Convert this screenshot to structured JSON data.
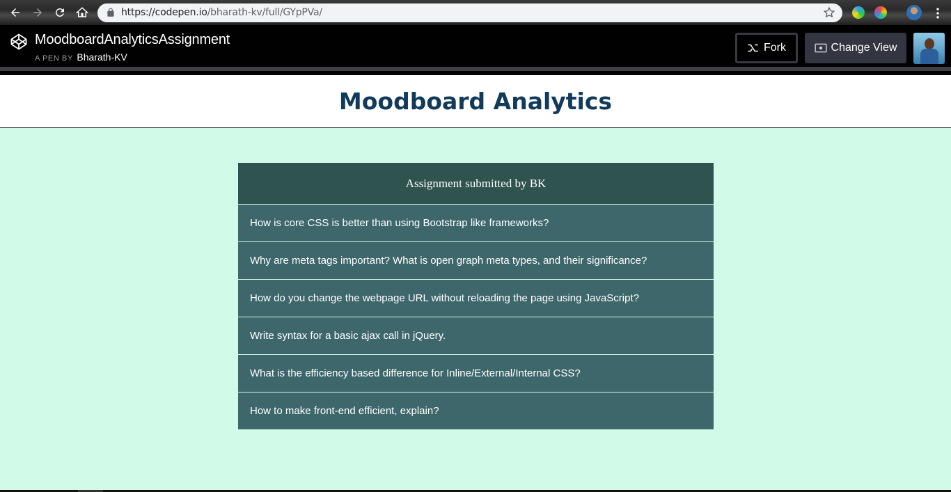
{
  "browser": {
    "url_host": "https://codepen.io",
    "url_path": "/bharath-kv/full/GYpPVa/"
  },
  "codepen": {
    "pen_title": "MoodboardAnalyticsAssignment",
    "by_label": "A PEN BY",
    "author": "Bharath-KV",
    "fork_label": "Fork",
    "change_view_label": "Change View"
  },
  "page": {
    "title": "Moodboard Analytics",
    "card_header": "Assignment submitted by BK",
    "questions": [
      "How is core CSS is better than using Bootstrap like frameworks?",
      "Why are meta tags important? What is open graph meta types, and their significance?",
      "How do you change the webpage URL without reloading the page using JavaScript?",
      "Write syntax for a basic ajax call in jQuery.",
      "What is the efficiency based difference for Inline/External/Internal CSS?",
      "How to make front-end efficient, explain?"
    ]
  },
  "colors": {
    "page_background": "#d1fbe8",
    "card_header": "#2f5450",
    "card_item": "#3e676b",
    "title": "#123a5a"
  },
  "icons": [
    "back-icon",
    "forward-icon",
    "reload-icon",
    "home-icon",
    "lock-icon",
    "star-icon",
    "codepen-logo-icon",
    "fork-icon",
    "eye-icon",
    "menu-icon"
  ]
}
